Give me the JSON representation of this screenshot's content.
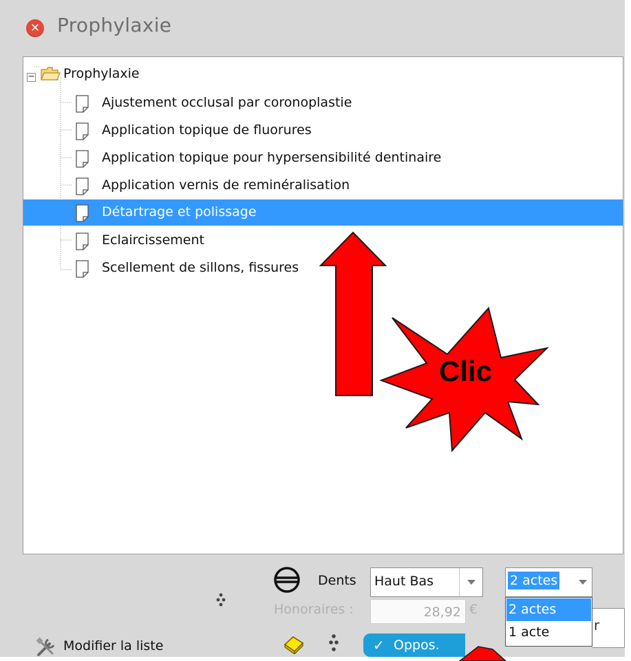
{
  "window": {
    "title": "Prophylaxie",
    "close_icon": "close-icon"
  },
  "tree": {
    "root_label": "Prophylaxie",
    "expander_symbol": "−",
    "items": [
      {
        "label": "Ajustement occlusal par coronoplastie",
        "selected": false
      },
      {
        "label": "Application topique de fluorures",
        "selected": false
      },
      {
        "label": "Application topique pour hypersensibilité dentinaire",
        "selected": false
      },
      {
        "label": "Application vernis de reminéralisation",
        "selected": false
      },
      {
        "label": "Détartrage et polissage",
        "selected": true
      },
      {
        "label": "Eclaircissement",
        "selected": false
      },
      {
        "label": "Scellement de sillons, fissures",
        "selected": false
      }
    ]
  },
  "bottom": {
    "dents_label": "Dents",
    "dents_value": "Haut Bas",
    "actes_value": "2 actes",
    "actes_options": [
      "2 actes",
      "1 acte"
    ],
    "honoraires_label": "Honoraires :",
    "honoraires_value": "28,92",
    "currency": "€",
    "modifier_label": "Modifier la liste",
    "oppos_label": "Oppos.",
    "behind_glyph": "r"
  },
  "annotation": {
    "callout_text": "Clic",
    "arrow_color": "#ff0000",
    "star_color": "#ff0000"
  },
  "colors": {
    "selection": "#3399ff",
    "window_bg": "#d8d8d8",
    "close": "#e24a3b",
    "oppos": "#1f9fd9"
  }
}
